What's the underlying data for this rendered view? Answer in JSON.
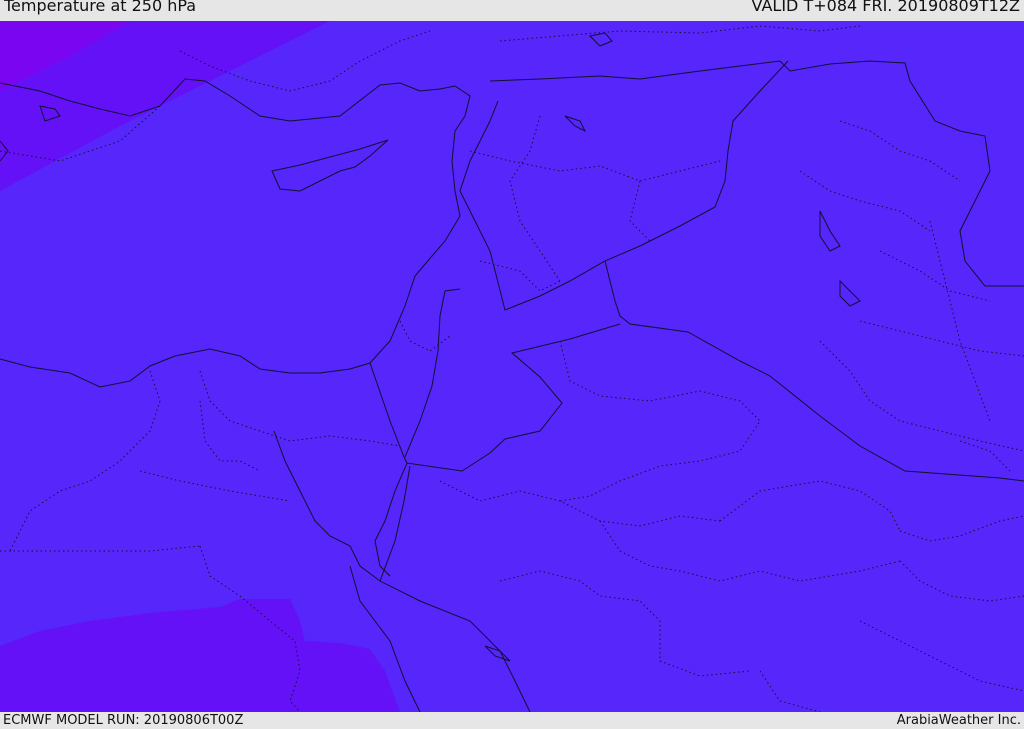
{
  "header": {
    "title": "Temperature at 250 hPa",
    "valid": "VALID T+084 FRI. 20190809T12Z"
  },
  "footer": {
    "model_run": "ECMWF MODEL RUN: 20190806T00Z",
    "credit": "ArabiaWeather Inc."
  },
  "colors": {
    "field_main": "#5626fb",
    "field_warm": "#6411f7",
    "field_warmest": "#7a05f0",
    "coast_line": "#111133"
  }
}
